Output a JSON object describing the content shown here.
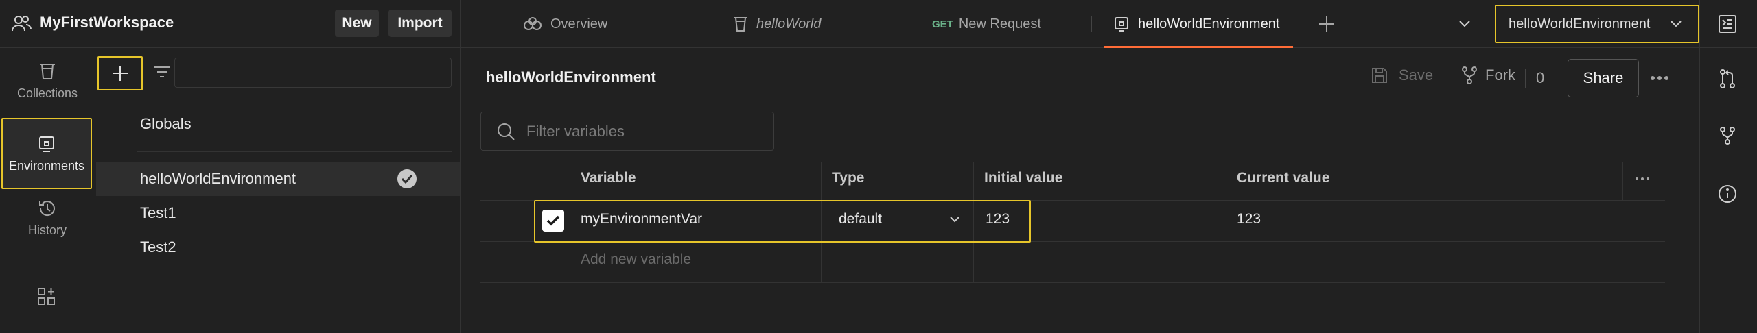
{
  "workspace": {
    "title": "MyFirstWorkspace",
    "new_label": "New",
    "import_label": "Import"
  },
  "tabs": [
    {
      "label": "Overview"
    },
    {
      "label": "helloWorld"
    },
    {
      "method": "GET",
      "label": "New Request"
    },
    {
      "label": "helloWorldEnvironment"
    }
  ],
  "env_selector": {
    "selected": "helloWorldEnvironment"
  },
  "rail": {
    "collections": "Collections",
    "environments": "Environments",
    "history": "History"
  },
  "env_list": {
    "globals": "Globals",
    "items": [
      "helloWorldEnvironment",
      "Test1",
      "Test2"
    ]
  },
  "editor": {
    "title": "helloWorldEnvironment",
    "save_label": "Save",
    "fork_label": "Fork",
    "fork_count": "0",
    "share_label": "Share",
    "filter_placeholder": "Filter variables"
  },
  "table": {
    "headers": {
      "variable": "Variable",
      "type": "Type",
      "initial": "Initial value",
      "current": "Current value"
    },
    "rows": [
      {
        "variable": "myEnvironmentVar",
        "type": "default",
        "initial": "123",
        "current": "123",
        "enabled": true
      }
    ],
    "add_placeholder": "Add new variable"
  },
  "colors": {
    "accent": "#ff6c37",
    "highlight": "#e6c52a",
    "background": "#212121"
  }
}
